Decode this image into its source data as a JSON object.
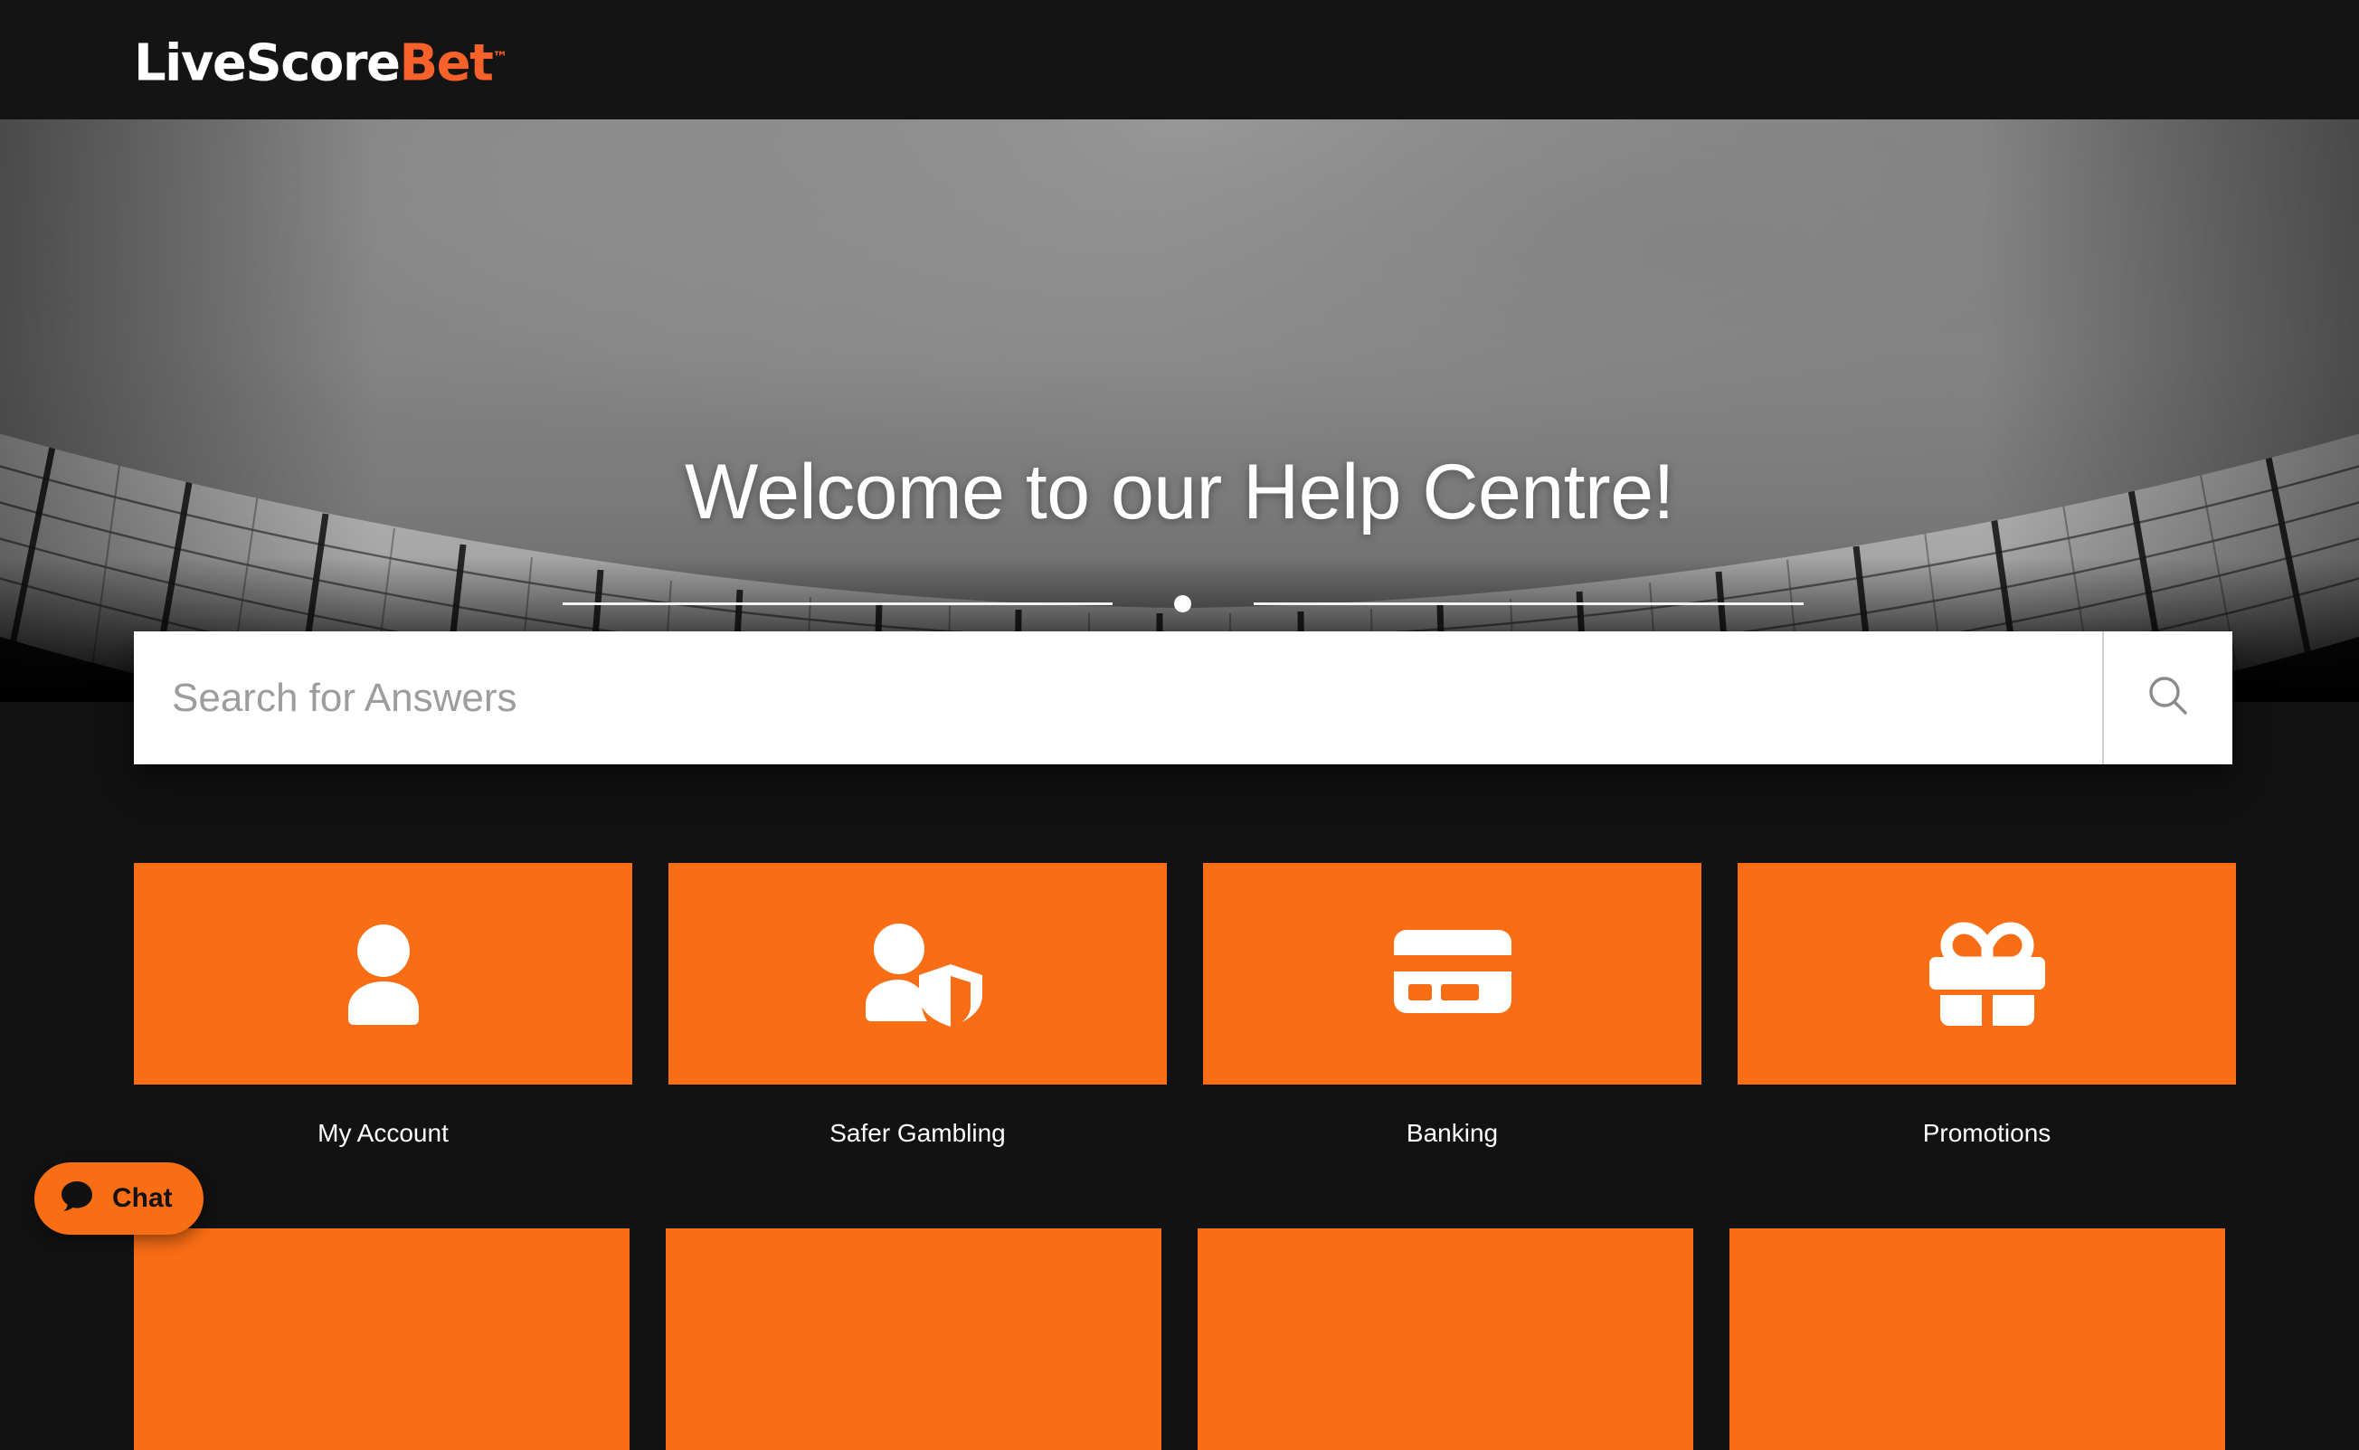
{
  "header": {
    "logo": {
      "white_text": "LiveScore",
      "orange_text": "Bet",
      "trademark": "™"
    }
  },
  "hero": {
    "title": "Welcome to our Help Centre!",
    "background_description": "stadium-roof-greyscale"
  },
  "search": {
    "placeholder": "Search for Answers",
    "value": "",
    "button_icon": "search-icon"
  },
  "categories": [
    {
      "label": "My Account",
      "icon": "user-icon"
    },
    {
      "label": "Safer Gambling",
      "icon": "user-shield-icon"
    },
    {
      "label": "Banking",
      "icon": "credit-card-icon"
    },
    {
      "label": "Promotions",
      "icon": "gift-icon"
    }
  ],
  "chat_widget": {
    "label": "Chat",
    "icon": "chat-bubble-icon"
  },
  "colors": {
    "brand_orange": "#F96D15",
    "page_background": "#121212",
    "header_background": "#141414",
    "text_white": "#FFFFFF",
    "placeholder_grey": "#9D9D9D"
  }
}
